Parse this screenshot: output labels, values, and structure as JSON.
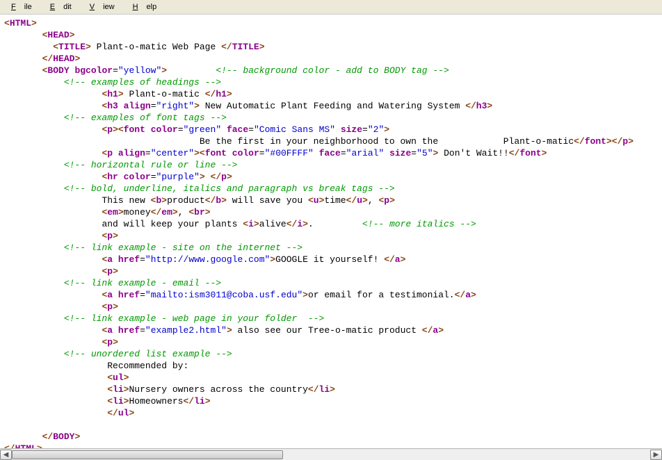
{
  "menu": {
    "file": "File",
    "edit": "Edit",
    "view": "View",
    "help": "Help"
  },
  "code": {
    "l01_tag": "HTML",
    "l02_tag": "HEAD",
    "l03_tag": "TITLE",
    "l03_txt": " Plant-o-matic Web Page ",
    "l04_tag": "HEAD",
    "l05_tag": "BODY",
    "l05_attr": "bgcolor",
    "l05_val": "\"yellow\"",
    "l05_cmt": "<!-- background color - add to BODY tag -->",
    "l06_cmt": "<!-- examples of headings -->",
    "l07_tag": "h1",
    "l07_txt": " Plant-o-matic ",
    "l08_tag": "h3",
    "l08_attr": "align",
    "l08_val": "\"right\"",
    "l08_txt": " New Automatic Plant Feeding and Watering System ",
    "l09_cmt": "<!-- examples of font tags -->",
    "l10_tag_p": "p",
    "l10_tag_font": "font",
    "l10_a1": "color",
    "l10_v1": "\"green\"",
    "l10_a2": "face",
    "l10_v2": "\"Comic Sans MS\"",
    "l10_a3": "size",
    "l10_v3": "\"2\"",
    "l11_txt": "Be the first in your neighborhood to own the            Plant-o-matic",
    "l12_tag_p": "p",
    "l12_a1": "align",
    "l12_v1": "\"center\"",
    "l12_tag_font": "font",
    "l12_a2": "color",
    "l12_v2": "\"#00FFFF\"",
    "l12_a3": "face",
    "l12_v3": "\"arial\"",
    "l12_a4": "size",
    "l12_v4": "\"5\"",
    "l12_txt": " Don't Wait!!",
    "l13_cmt": "<!-- horizontal rule or line -->",
    "l14_tag": "hr",
    "l14_attr": "color",
    "l14_val": "\"purple\"",
    "l14_tagp": "p",
    "l15_cmt": "<!-- bold, underline, italics and paragraph vs break tags -->",
    "l16_t1": "This new ",
    "l16_b": "b",
    "l16_t2": "product",
    "l16_t3": " will save you ",
    "l16_u": "u",
    "l16_t4": "time",
    "l16_t5": ", ",
    "l16_p": "p",
    "l17_em": "em",
    "l17_t1": "money",
    "l17_t2": ", ",
    "l17_br": "br",
    "l18_t1": "and will keep your plants ",
    "l18_i": "i",
    "l18_t2": "alive",
    "l18_t3": ".",
    "l18_cmt": "<!-- more italics -->",
    "l19_p": "p",
    "l20_cmt": "<!-- link example - site on the internet -->",
    "l21_a": "a",
    "l21_attr": "href",
    "l21_val": "\"http://www.google.com\"",
    "l21_txt": "GOOGLE it yourself! ",
    "l22_p": "p",
    "l23_cmt": "<!-- link example - email -->",
    "l24_a": "a",
    "l24_attr": "href",
    "l24_val": "\"mailto:ism3011@coba.usf.edu\"",
    "l24_txt": "or email for a testimonial.",
    "l25_p": "p",
    "l26_cmt": "<!-- link example - web page in your folder  -->",
    "l27_a": "a",
    "l27_attr": "href",
    "l27_val": "\"example2.html\"",
    "l27_txt": " also see our Tree-o-matic product ",
    "l28_p": "p",
    "l29_cmt": "<!-- unordered list example -->",
    "l30_txt": "Recommended by:",
    "l31_ul": "ul",
    "l32_li": "li",
    "l32_txt": "Nursery owners across the country",
    "l33_li": "li",
    "l33_txt": "Homeowners",
    "l34_ul": "ul",
    "l36_body": "BODY",
    "l37_html": "HTML"
  }
}
